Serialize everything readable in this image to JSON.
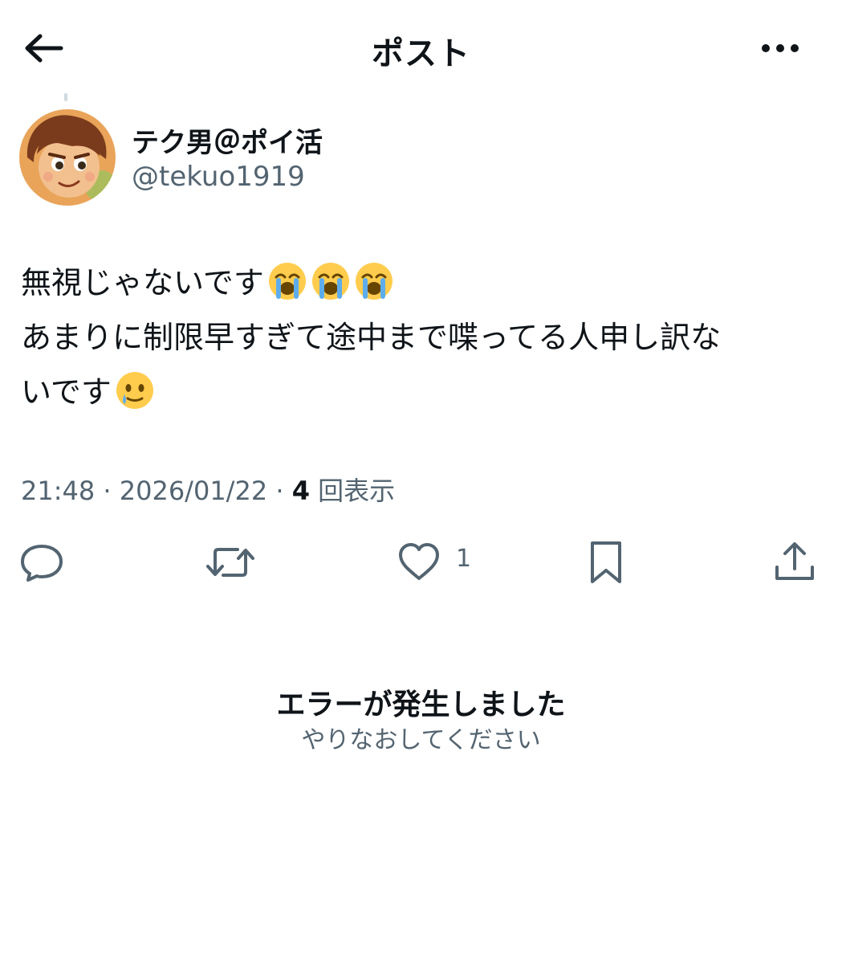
{
  "header": {
    "title": "ポスト",
    "back_icon": "arrow-left-icon",
    "more_icon": "more-dots-icon"
  },
  "author": {
    "display_name": "テク男＠ポイ活",
    "handle": "@tekuo1919",
    "avatar_icon": "cartoon-boy-avatar"
  },
  "post": {
    "line1": "無視じゃないです",
    "line1_emojis": [
      "loudly-crying-face-emoji",
      "loudly-crying-face-emoji",
      "loudly-crying-face-emoji"
    ],
    "line2": "あまりに制限早すぎて途中まで喋ってる人申し訳な",
    "line3": "いです",
    "line3_emoji": "face-holding-back-tears-emoji"
  },
  "meta": {
    "time": "21:48",
    "separator1": " · ",
    "date": "2026/01/22",
    "separator2": " · ",
    "views_count": "4",
    "views_label": " 回表示"
  },
  "actions": {
    "reply_icon": "reply-icon",
    "repost_icon": "repost-icon",
    "like_icon": "heart-icon",
    "like_count": "1",
    "bookmark_icon": "bookmark-icon",
    "share_icon": "share-icon"
  },
  "error": {
    "title": "エラーが発生しました",
    "retry": "やりなおしてください"
  },
  "colors": {
    "text_primary": "#0f1419",
    "text_secondary": "#536471",
    "background": "#ffffff"
  }
}
